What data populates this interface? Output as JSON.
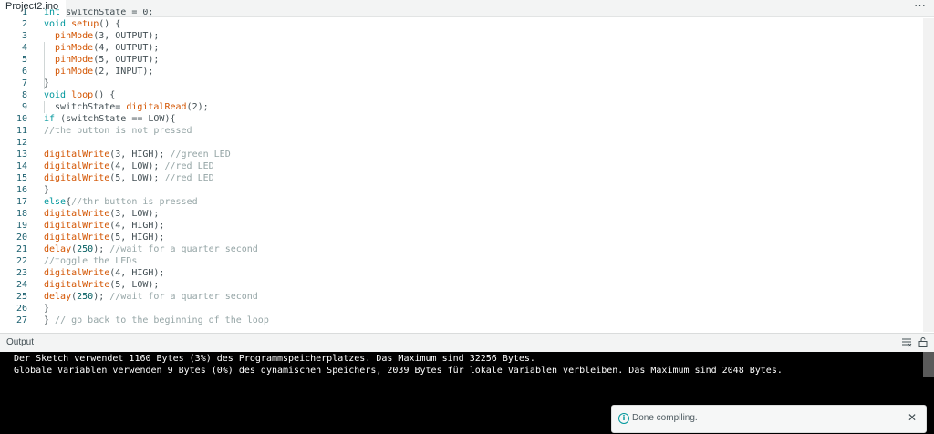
{
  "tab": {
    "label": "Project2.ino"
  },
  "editor": {
    "lines": [
      {
        "n": "1",
        "tokens": [
          [
            "kw",
            "int"
          ],
          [
            "pl",
            " switchState = 0;"
          ]
        ]
      },
      {
        "n": "2",
        "tokens": [
          [
            "kw",
            "void"
          ],
          [
            "pl",
            " "
          ],
          [
            "fn",
            "setup"
          ],
          [
            "pl",
            "() {"
          ]
        ]
      },
      {
        "n": "3",
        "tokens": [
          [
            "pl",
            "  "
          ],
          [
            "fn",
            "pinMode"
          ],
          [
            "pl",
            "(3, OUTPUT);"
          ]
        ]
      },
      {
        "n": "4",
        "tokens": [
          [
            "pl",
            "  "
          ],
          [
            "fn",
            "pinMode"
          ],
          [
            "pl",
            "(4, OUTPUT);"
          ]
        ]
      },
      {
        "n": "5",
        "tokens": [
          [
            "pl",
            "  "
          ],
          [
            "fn",
            "pinMode"
          ],
          [
            "pl",
            "(5, OUTPUT);"
          ]
        ]
      },
      {
        "n": "6",
        "tokens": [
          [
            "pl",
            "  "
          ],
          [
            "fn",
            "pinMode"
          ],
          [
            "pl",
            "(2, INPUT);"
          ]
        ]
      },
      {
        "n": "7",
        "tokens": [
          [
            "pl",
            "}"
          ]
        ]
      },
      {
        "n": "8",
        "tokens": [
          [
            "kw",
            "void"
          ],
          [
            "pl",
            " "
          ],
          [
            "fn",
            "loop"
          ],
          [
            "pl",
            "() {"
          ]
        ]
      },
      {
        "n": "9",
        "tokens": [
          [
            "pl",
            "  switchState= "
          ],
          [
            "fn",
            "digitalRead"
          ],
          [
            "pl",
            "(2);"
          ]
        ]
      },
      {
        "n": "10",
        "tokens": [
          [
            "kw",
            "if"
          ],
          [
            "pl",
            " (switchState == LOW){"
          ]
        ]
      },
      {
        "n": "11",
        "tokens": [
          [
            "cm",
            "//the button is not pressed"
          ]
        ]
      },
      {
        "n": "12",
        "tokens": []
      },
      {
        "n": "13",
        "tokens": [
          [
            "fn",
            "digitalWrite"
          ],
          [
            "pl",
            "(3, HIGH); "
          ],
          [
            "cm",
            "//green LED"
          ]
        ]
      },
      {
        "n": "14",
        "tokens": [
          [
            "fn",
            "digitalWrite"
          ],
          [
            "pl",
            "(4, LOW); "
          ],
          [
            "cm",
            "//red LED"
          ]
        ]
      },
      {
        "n": "15",
        "tokens": [
          [
            "fn",
            "digitalWrite"
          ],
          [
            "pl",
            "(5, LOW); "
          ],
          [
            "cm",
            "//red LED"
          ]
        ]
      },
      {
        "n": "16",
        "tokens": [
          [
            "pl",
            "}"
          ]
        ]
      },
      {
        "n": "17",
        "tokens": [
          [
            "kw",
            "else"
          ],
          [
            "pl",
            "{"
          ],
          [
            "cm",
            "//thr button is pressed"
          ]
        ]
      },
      {
        "n": "18",
        "tokens": [
          [
            "fn",
            "digitalWrite"
          ],
          [
            "pl",
            "(3, LOW);"
          ]
        ]
      },
      {
        "n": "19",
        "tokens": [
          [
            "fn",
            "digitalWrite"
          ],
          [
            "pl",
            "(4, HIGH);"
          ]
        ]
      },
      {
        "n": "20",
        "tokens": [
          [
            "fn",
            "digitalWrite"
          ],
          [
            "pl",
            "(5, HIGH);"
          ]
        ]
      },
      {
        "n": "21",
        "tokens": [
          [
            "fn",
            "delay"
          ],
          [
            "pl",
            "("
          ],
          [
            "num",
            "250"
          ],
          [
            "pl",
            "); "
          ],
          [
            "cm",
            "//wait for a quarter second"
          ]
        ]
      },
      {
        "n": "22",
        "tokens": [
          [
            "cm",
            "//toggle the LEDs"
          ]
        ]
      },
      {
        "n": "23",
        "tokens": [
          [
            "fn",
            "digitalWrite"
          ],
          [
            "pl",
            "(4, HIGH);"
          ]
        ]
      },
      {
        "n": "24",
        "tokens": [
          [
            "fn",
            "digitalWrite"
          ],
          [
            "pl",
            "(5, LOW);"
          ]
        ]
      },
      {
        "n": "25",
        "tokens": [
          [
            "fn",
            "delay"
          ],
          [
            "pl",
            "("
          ],
          [
            "num",
            "250"
          ],
          [
            "pl",
            "); "
          ],
          [
            "cm",
            "//wait for a quarter second"
          ]
        ]
      },
      {
        "n": "26",
        "tokens": [
          [
            "pl",
            "}"
          ]
        ]
      },
      {
        "n": "27",
        "tokens": [
          [
            "pl",
            "} "
          ],
          [
            "cm",
            "// go back to the beginning of the loop"
          ]
        ]
      }
    ]
  },
  "output": {
    "title": "Output",
    "lines": [
      "Der Sketch verwendet 1160 Bytes (3%) des Programmspeicherplatzes. Das Maximum sind 32256 Bytes.",
      "Globale Variablen verwenden 9 Bytes (0%) des dynamischen Speichers, 2039 Bytes für lokale Variablen verbleiben. Das Maximum sind 2048 Bytes."
    ]
  },
  "toast": {
    "message": "Done compiling."
  },
  "colors": {
    "accent": "#00979c",
    "keyword": "#00979c",
    "function": "#d35400",
    "comment": "#95a5a6",
    "console_bg": "#000000"
  },
  "icons": {
    "tab_menu": "more-icon",
    "clear_output": "clear-output-icon",
    "lock_scroll": "lock-icon",
    "toast_info": "info-icon",
    "toast_close": "close-icon"
  }
}
